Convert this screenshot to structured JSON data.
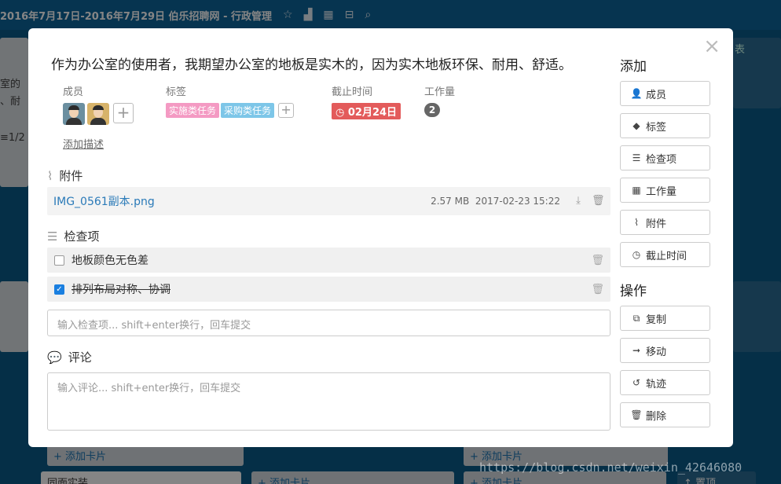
{
  "topbar": {
    "title": "2016年7月17日-2016年7月29日  伯乐招聘网 - 行政管理"
  },
  "background": {
    "left_text_1": "室的",
    "left_text_2": "、耐",
    "left_text_3": "≡1/2",
    "right_text_1": "表",
    "bottom_card_left": "同面实装",
    "add_card_1": "+ 添加卡片",
    "add_card_2": "+ 添加卡片",
    "add_card_top_1": "+ 添加卡片",
    "add_card_top_2": "+ 添加卡片",
    "bottom_right": "↑ 置顶"
  },
  "modal": {
    "close": "×",
    "title": "作为办公室的使用者，我期望办公室的地板是实木的，因为实木地板环保、耐用、舒适。",
    "members_label": "成员",
    "labels_label": "标签",
    "tags": [
      "实施类任务",
      "采购类任务"
    ],
    "due_label": "截止时间",
    "due_value": "02月24日",
    "workload_label": "工作量",
    "workload_value": "2",
    "add_description": "添加描述",
    "attachments_heading": "附件",
    "attachment": {
      "name": "IMG_0561副本.png",
      "size": "2.57 MB",
      "date": "2017-02-23 15:22"
    },
    "checklist_heading": "检查项",
    "checklist": [
      {
        "text": "地板颜色无色差",
        "checked": false
      },
      {
        "text": "排列布局对称、协调",
        "checked": true
      }
    ],
    "checklist_placeholder": "输入检查项... shift+enter换行，回车提交",
    "comments_heading": "评论",
    "comment_placeholder": "输入评论... shift+enter换行，回车提交"
  },
  "sidebar": {
    "add_heading": "添加",
    "add_buttons": [
      "成员",
      "标签",
      "检查项",
      "工作量",
      "附件",
      "截止时间"
    ],
    "actions_heading": "操作",
    "action_buttons": [
      "复制",
      "移动",
      "轨迹",
      "删除"
    ]
  },
  "watermark": "https://blog.csdn.net/weixin_42646080",
  "colors": {
    "tag_pink": "#f49ac3",
    "tag_blue": "#7dc6e8",
    "due_red": "#e35b5b",
    "link_blue": "#2a7ab8",
    "board_blue": "#0b5a88"
  }
}
